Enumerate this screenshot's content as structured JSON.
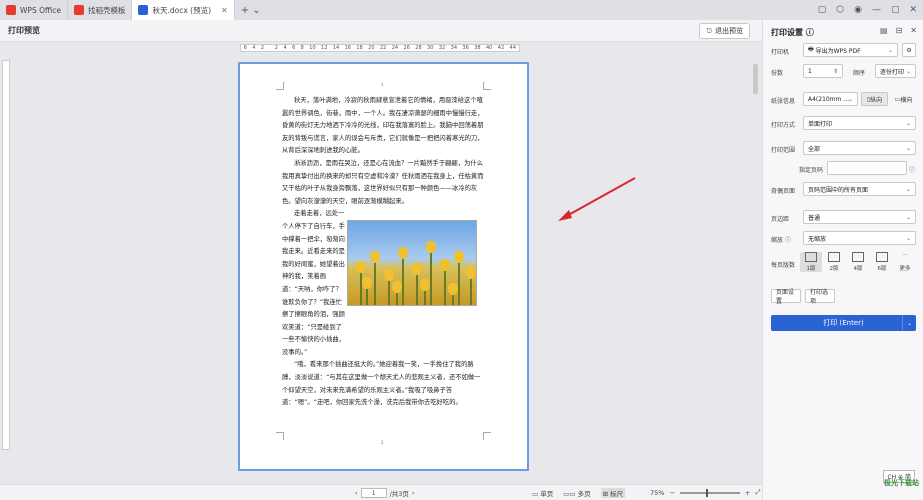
{
  "tabs": [
    {
      "label": "WPS Office",
      "icon": "wps-logo-icon",
      "color": "#e63b2e"
    },
    {
      "label": "找稻壳模板",
      "icon": "docer-logo-icon",
      "color": "#e63b2e"
    },
    {
      "label": "秋天.docx (预览)",
      "icon": "word-doc-icon",
      "color": "#2b5fd9"
    }
  ],
  "toolbar": {
    "title": "打印预览",
    "exit_label": "退出预览"
  },
  "ruler": {
    "marks": [
      "6",
      "4",
      "2",
      "",
      "2",
      "4",
      "6",
      "8",
      "10",
      "12",
      "14",
      "16",
      "18",
      "20",
      "22",
      "24",
      "26",
      "28",
      "30",
      "32",
      "34",
      "36",
      "38",
      "40",
      "42",
      "44"
    ]
  },
  "document": {
    "paragraphs": [
      "秋天，落叶满地，冷寂的秋雨肆意宣泄着它的情绪，用惡漆给这个喧嚣的世界调色，街巷，雨中，一个人。我在凄凉萧瑟的细雨中慢慢行走，昏黄的街灯无力地洒下冷冷的光线，印在我落寞的脸上。我脑中回荡着朋友的背叛与谎言，家人的误会与斥责，它们就像是一把把闪着寒光的刀，从背后深深地刺进我的心脏。",
      "淅淅沥沥，是雨在哭泣，还是心在流血？一片黯然手于翩翩，为什么我用真挚付出的换来的却只有空虚和冷漠？任秋雨洒在我身上，任枯黄而又干枯的叶子从我身旁飘落，这世界好似只有那一种颜色——冰冷的灰色。望向灰濛濛的天空，眼前逐渐模糊起来。",
      "走着走着，远处一个人停下了自行车，手中撑着一把伞，匆匆向我走来。近看走来的是我的好闺蜜，她望着出神的我，笑着画道：“天呐，你咋了？谁欺负你了？”我连忙擦了擦眼角的泪，强颜欢笑道：“只是碰到了一些不愉快的小插曲，没事的。”",
      "“哦，看来那个插曲还挺大的。”她迎着我一笑，一手挽住了我的胳膊，淡淡说道：“与其在这里做一个颓天尤人的悲观主义者，还不如做一个仰望天空，对未来充满希望的乐观主义者。”我吸了吸鼻子答道：“嗯”。“走吧，你回家先洗个澡，洗完后我带你去吃好吃的。"
    ],
    "page_num_top": "1",
    "page_num_bottom": "2"
  },
  "status": {
    "page_value": "1",
    "page_total": "/共3页",
    "single": "单页",
    "multi": "多页",
    "ruler": "标尺",
    "zoom": "75%",
    "zoom_level": 0.45
  },
  "panel": {
    "title": "打印设置",
    "printer_label": "打印机",
    "printer_value": "导出为WPS PDF",
    "copies_label": "份数",
    "copies_value": "1",
    "order_label": "顺序",
    "order_value": "逐份打印",
    "paper_label": "纸张信息",
    "paper_value": "A4(210mm ...",
    "portrait": "纵向",
    "landscape": "横向",
    "mode_label": "打印方式",
    "mode_value": "单面打印",
    "range_label": "打印范围",
    "range_value": "全部",
    "pages_label": "指定页码",
    "pages_value": "",
    "scope_label": "奇偶页面",
    "scope_value": "页码范围中的所有页面",
    "margin_label": "页边距",
    "margin_value": "普通",
    "scale_label": "缩放",
    "scale_value": "无缩放",
    "per_sheet_label": "每页版数",
    "layouts": [
      "1版",
      "2版",
      "4版",
      "6版",
      "更多"
    ],
    "page_setup": "页面设置",
    "print_options": "打印选项",
    "print_button": "打印 (Enter)"
  },
  "ime": "CH ⊕ 简",
  "watermark": "极光下载站"
}
